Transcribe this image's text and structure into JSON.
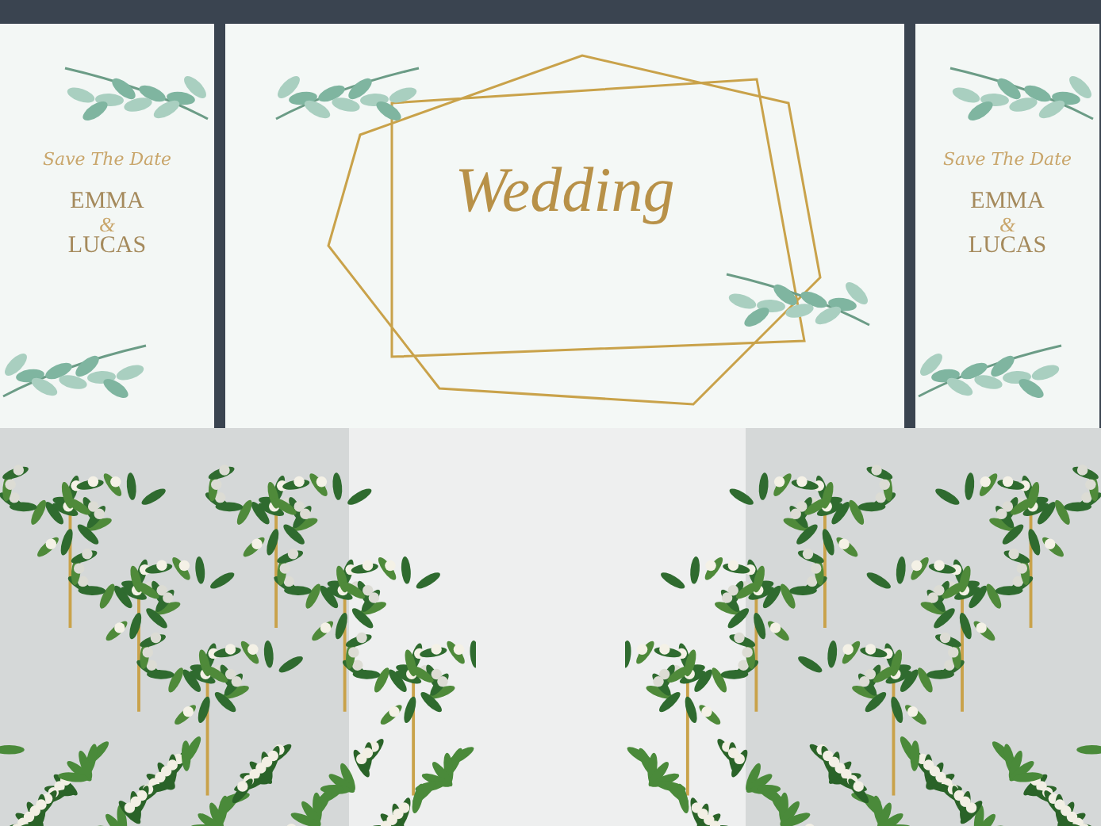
{
  "side_banners": [
    {
      "heading": "Save The Date",
      "name_1": "EMMA",
      "ampersand": "&",
      "name_2": "LUCAS"
    },
    {
      "heading": "Save The Date",
      "name_1": "EMMA",
      "ampersand": "&",
      "name_2": "LUCAS"
    }
  ],
  "main_banner": {
    "title": "Wedding"
  }
}
